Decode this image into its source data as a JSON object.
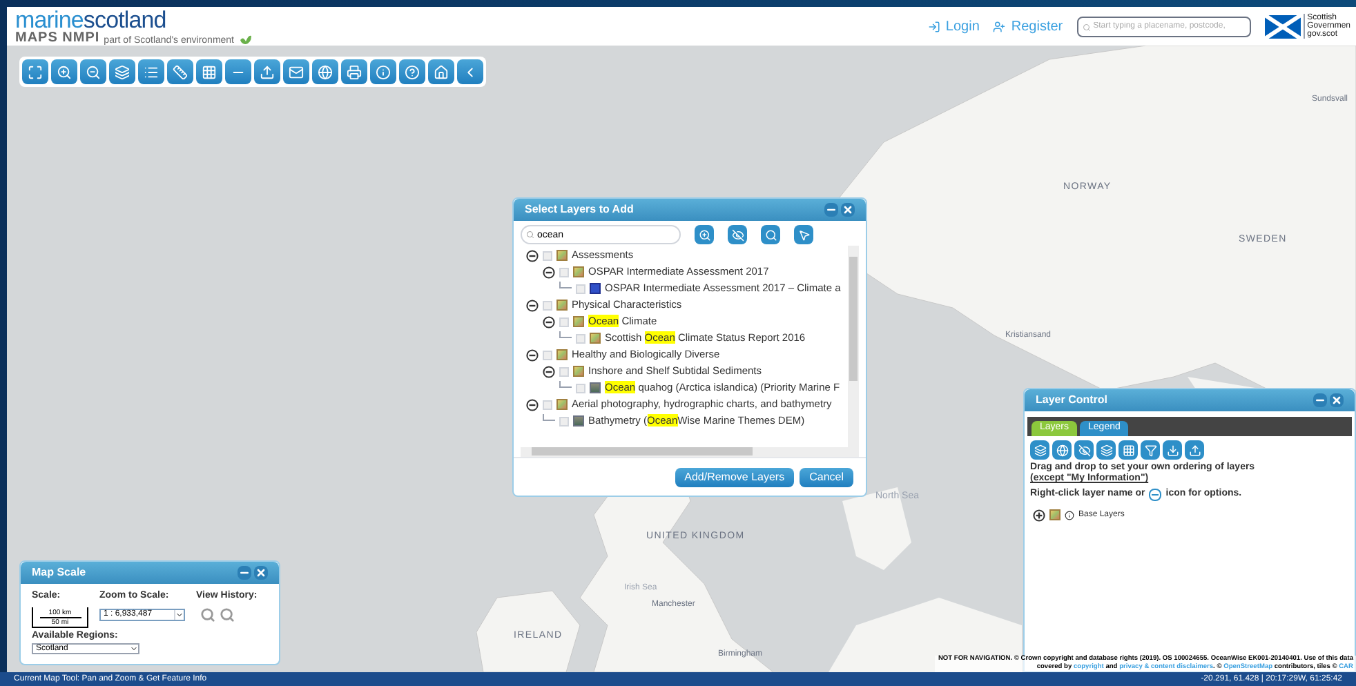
{
  "header": {
    "logo_primary": "marine",
    "logo_secondary": "scotland",
    "product": "MAPS NMPI",
    "tagline": "part of Scotland's environment",
    "login": "Login",
    "register": "Register",
    "search_placeholder": "Start typing a placename, postcode, ",
    "gov_logo": [
      "Scottish",
      "Governmen",
      "gov.scot"
    ]
  },
  "map_labels": [
    {
      "text": "Sundsvall"
    },
    {
      "text": "NORWAY"
    },
    {
      "text": "SWEDEN"
    },
    {
      "text": "Kristiansand"
    },
    {
      "text": "North Sea"
    },
    {
      "text": "UNITED KINGDOM"
    },
    {
      "text": "Irish Sea"
    },
    {
      "text": "Manchester"
    },
    {
      "text": "IRELAND"
    },
    {
      "text": "Birmingham"
    }
  ],
  "layer_dialog": {
    "title": "Select Layers to Add",
    "search": "ocean",
    "tree": [
      {
        "kind": "group",
        "checked": false,
        "expanded": true,
        "parts": [
          {
            "text": "Assessments",
            "highlight": false
          }
        ],
        "children": [
          {
            "kind": "group",
            "checked": false,
            "expanded": true,
            "parts": [
              {
                "text": "OSPAR Intermediate Assessment 2017",
                "highlight": false
              }
            ],
            "children": [
              {
                "kind": "layer",
                "checked": false,
                "parts": [
                  {
                    "text": "OSPAR Intermediate Assessment 2017 – Climate a",
                    "highlight": false
                  }
                ]
              }
            ]
          }
        ]
      },
      {
        "kind": "group",
        "checked": false,
        "expanded": true,
        "parts": [
          {
            "text": "Physical Characteristics",
            "highlight": false
          }
        ],
        "children": [
          {
            "kind": "group",
            "checked": false,
            "expanded": true,
            "parts": [
              {
                "text": "Ocean",
                "highlight": true
              },
              {
                "text": " Climate",
                "highlight": false
              }
            ],
            "children": [
              {
                "kind": "group",
                "checked": false,
                "parts": [
                  {
                    "text": "Scottish ",
                    "highlight": false
                  },
                  {
                    "text": "Ocean",
                    "highlight": true
                  },
                  {
                    "text": " Climate Status Report 2016",
                    "highlight": false
                  }
                ]
              }
            ]
          }
        ]
      },
      {
        "kind": "group",
        "checked": false,
        "expanded": true,
        "parts": [
          {
            "text": "Healthy and Biologically Diverse",
            "highlight": false
          }
        ],
        "children": [
          {
            "kind": "group",
            "checked": false,
            "expanded": true,
            "parts": [
              {
                "text": "Inshore and Shelf Subtidal Sediments",
                "highlight": false
              }
            ],
            "children": [
              {
                "kind": "image",
                "checked": false,
                "parts": [
                  {
                    "text": "Ocean",
                    "highlight": true
                  },
                  {
                    "text": " quahog (Arctica islandica) (Priority Marine F",
                    "highlight": false
                  }
                ]
              }
            ]
          }
        ]
      },
      {
        "kind": "group",
        "checked": false,
        "expanded": true,
        "parts": [
          {
            "text": "Aerial photography, hydrographic charts, and bathymetry",
            "highlight": false
          }
        ],
        "children": [
          {
            "kind": "image",
            "checked": false,
            "parts": [
              {
                "text": "Bathymetry (",
                "highlight": false
              },
              {
                "text": "Ocean",
                "highlight": true
              },
              {
                "text": "Wise Marine Themes DEM)",
                "highlight": false
              }
            ]
          }
        ]
      }
    ],
    "buttons": [
      "Add/Remove Layers",
      "Cancel"
    ]
  },
  "layer_control": {
    "title": "Layer Control",
    "tabs": [
      {
        "label": "Layers",
        "selected": true
      },
      {
        "label": "Legend",
        "selected": false
      }
    ],
    "instruction": "Drag and drop to set your own ordering of layers",
    "instruction_link": "(except \"My Information\")",
    "hint_before": "Right-click layer name or",
    "hint_after": "icon for options.",
    "tree": [
      {
        "label": "Base Layers",
        "expanded": false
      }
    ]
  },
  "map_scale": {
    "title": "Map Scale",
    "scale_label": "Scale:",
    "scale_km": "100 km",
    "scale_mi": "50 mi",
    "zoom_label": "Zoom to Scale:",
    "zoom_value": "1 : 6,933,487",
    "history_label": "View History:",
    "regions_label": "Available Regions:",
    "region_value": "Scotland"
  },
  "attribution": {
    "line1": "NOT FOR NAVIGATION. © Crown copyright and database rights (2019). OS 100024655. OceanWise EK001-20140401. Use of this data",
    "line2": [
      {
        "text": "covered by ",
        "link": false
      },
      {
        "text": "copyright",
        "link": true
      },
      {
        "text": " and ",
        "link": false
      },
      {
        "text": "privacy & content disclaimers",
        "link": true
      },
      {
        "text": ". © ",
        "link": false
      },
      {
        "text": "OpenStreetMap",
        "link": true
      },
      {
        "text": " contributors, tiles © ",
        "link": false
      },
      {
        "text": "CAR",
        "link": true
      }
    ]
  },
  "status_bar": {
    "tool": "Current Map Tool: Pan and Zoom & Get Feature Info",
    "coordinates": "-20.291, 61.428 | 20:17:29W, 61:25:42"
  }
}
